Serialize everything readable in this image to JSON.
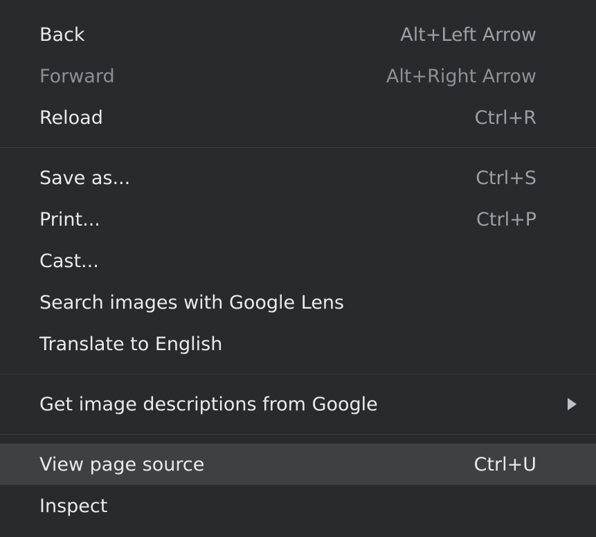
{
  "menu": {
    "groups": [
      {
        "items": [
          {
            "label": "Back",
            "shortcut": "Alt+Left Arrow"
          },
          {
            "label": "Forward",
            "shortcut": "Alt+Right Arrow",
            "disabled": true
          },
          {
            "label": "Reload",
            "shortcut": "Ctrl+R"
          }
        ]
      },
      {
        "items": [
          {
            "label": "Save as...",
            "shortcut": "Ctrl+S"
          },
          {
            "label": "Print...",
            "shortcut": "Ctrl+P"
          },
          {
            "label": "Cast...",
            "shortcut": ""
          },
          {
            "label": "Search images with Google Lens",
            "shortcut": ""
          },
          {
            "label": "Translate to English",
            "shortcut": ""
          }
        ]
      },
      {
        "items": [
          {
            "label": "Get image descriptions from Google",
            "shortcut": "",
            "submenu_icon": "chevron-right-icon"
          }
        ]
      },
      {
        "items": [
          {
            "label": "View page source",
            "shortcut": "Ctrl+U",
            "highlighted": true
          },
          {
            "label": "Inspect",
            "shortcut": ""
          }
        ]
      }
    ]
  },
  "colors": {
    "background": "#292a2d",
    "highlight": "#3f4043",
    "text": "#e8eaed",
    "shortcut_text": "#9aa0a6",
    "disabled_text": "#8c9096",
    "separator": "#3c3d40"
  }
}
